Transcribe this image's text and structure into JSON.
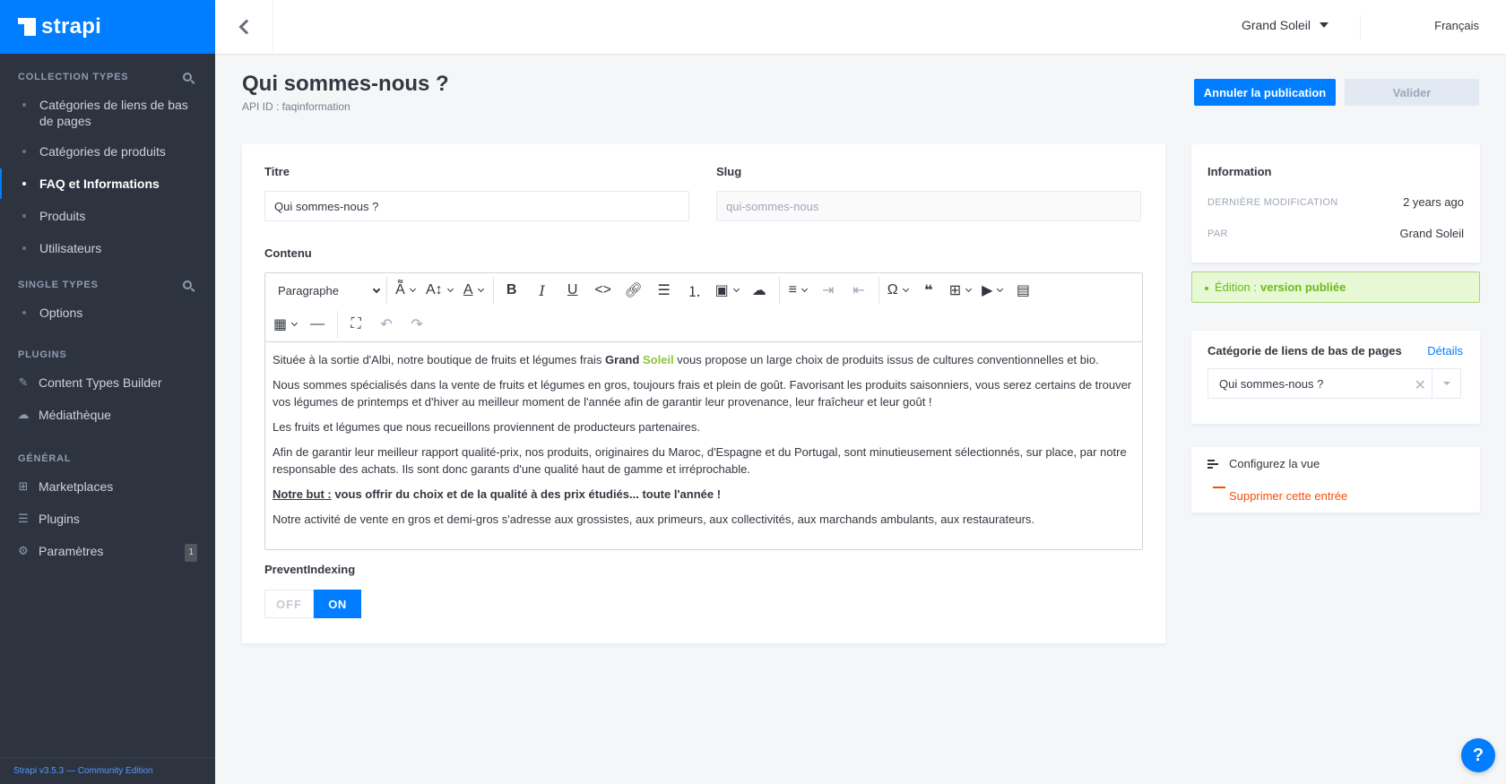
{
  "brand": {
    "name": "strapi"
  },
  "sidebar": {
    "collection_types": {
      "title": "Collection Types",
      "items": [
        {
          "label": "Catégories de liens de bas de pages"
        },
        {
          "label": "Catégories de produits"
        },
        {
          "label": "FAQ et Informations",
          "active": true
        },
        {
          "label": "Produits"
        },
        {
          "label": "Utilisateurs"
        }
      ]
    },
    "single_types": {
      "title": "Single Types",
      "items": [
        {
          "label": "Options"
        }
      ]
    },
    "plugins": {
      "title": "Plugins",
      "items": [
        {
          "label": "Content Types Builder",
          "icon": "pencil-icon"
        },
        {
          "label": "Médiathèque",
          "icon": "cloud-upload-icon"
        }
      ]
    },
    "general": {
      "title": "Général",
      "items": [
        {
          "label": "Marketplaces",
          "icon": "basket-icon"
        },
        {
          "label": "Plugins",
          "icon": "list-icon"
        },
        {
          "label": "Paramètres",
          "icon": "gear-icon",
          "badge": "1"
        }
      ]
    },
    "footer": "Strapi v3.5.3 — Community Edition"
  },
  "header": {
    "user": "Grand Soleil",
    "language": "Français"
  },
  "page": {
    "title": "Qui sommes-nous ?",
    "api_id": "API ID : faqinformation",
    "unpublish_label": "Annuler la publication",
    "validate_label": "Valider"
  },
  "form": {
    "titre_label": "Titre",
    "titre_value": "Qui sommes-nous ?",
    "slug_label": "Slug",
    "slug_value": "qui-sommes-nous",
    "contenu_label": "Contenu",
    "paragraph_select": "Paragraphe",
    "content": {
      "p1_before": "Située à la sortie d'Albi, notre boutique de fruits et légumes frais ",
      "p1_grand": "Grand",
      "p1_soleil": "Soleil",
      "p1_after": " vous propose un large choix de produits issus de cultures conventionnelles et bio.",
      "p2": "Nous sommes spécialisés dans la vente de fruits et légumes en gros, toujours frais et plein de goût. Favorisant les produits saisonniers, vous serez certains de trouver vos légumes de printemps et d'hiver au meilleur moment de l'année afin de garantir leur provenance, leur fraîcheur et leur goût !",
      "p3": "Les fruits et légumes que nous recueillons proviennent de producteurs partenaires.",
      "p4": "Afin de garantir leur meilleur rapport qualité-prix, nos produits, originaires du Maroc, d'Espagne et du Portugal, sont minutieusement sélectionnés, sur place, par notre responsable des achats. Ils sont donc garants d'une qualité haut de gamme et irréprochable.",
      "p5_label": "Notre but :",
      "p5_text": " vous offrir du choix et de la qualité à des prix étudiés... toute l'année !",
      "p6": "Notre activité de vente en gros et demi-gros s'adresse aux grossistes, aux primeurs, aux collectivités, aux marchands ambulants, aux restaurateurs."
    },
    "prevent_label": "PreventIndexing",
    "toggle_off": "OFF",
    "toggle_on": "ON",
    "prevent_value": "ON"
  },
  "info": {
    "title": "Information",
    "last_modified_label": "Dernière modification",
    "last_modified_value": "2 years ago",
    "by_label": "Par",
    "by_value": "Grand Soleil"
  },
  "status": {
    "prefix": "Édition :",
    "value": "version publiée"
  },
  "relation": {
    "title": "Catégorie de liens de bas de pages",
    "details_link": "Détails",
    "selected": "Qui sommes-nous ?"
  },
  "actions": {
    "configure": "Configurez la vue",
    "delete": "Supprimer cette entrée"
  },
  "help": "?",
  "colors": {
    "primary": "#007eff",
    "sidebar": "#2e3340",
    "danger": "#f64d0a",
    "success": "#6dbb1a",
    "brand_green": "#8cc43c"
  }
}
